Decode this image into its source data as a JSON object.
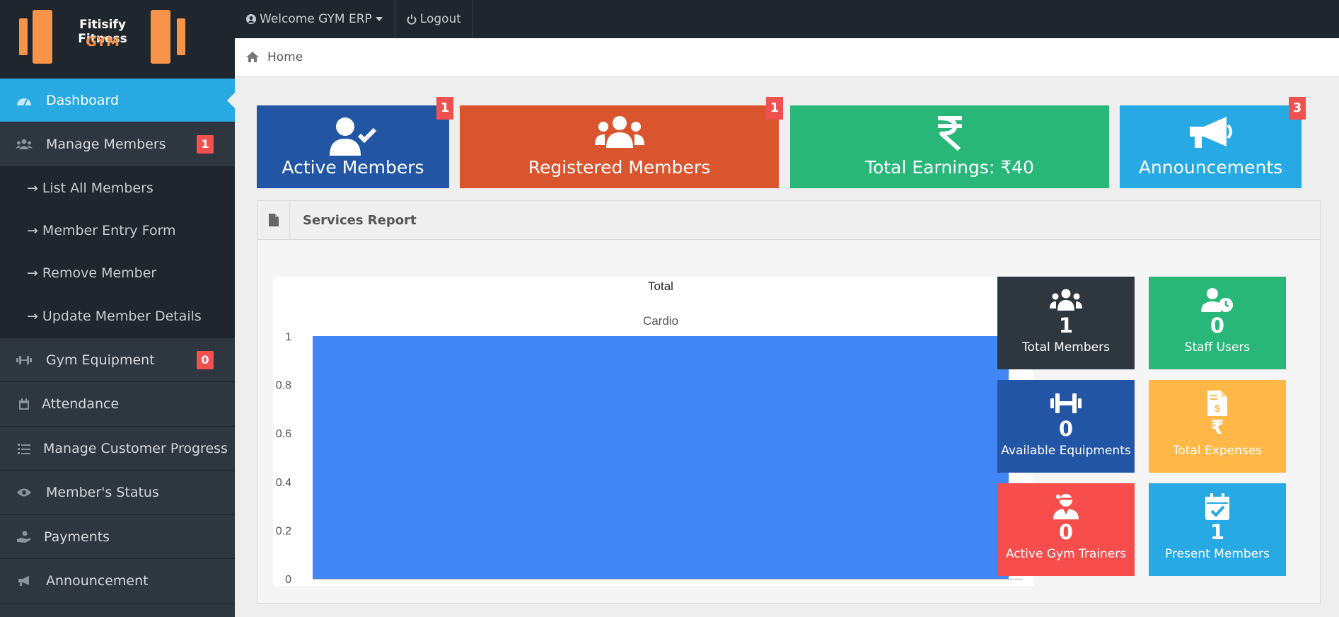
{
  "brand": {
    "line1": "Fitisify Fitness",
    "line2": "GYM"
  },
  "topbar": {
    "welcome": "Welcome GYM ERP",
    "logout": "Logout"
  },
  "breadcrumb": {
    "home": "Home"
  },
  "sidebar": {
    "dashboard": "Dashboard",
    "manage_members": {
      "label": "Manage Members",
      "badge": "1"
    },
    "submenu": [
      "List All Members",
      "Member Entry Form",
      "Remove Member",
      "Update Member Details"
    ],
    "gym_equipment": {
      "label": "Gym Equipment",
      "badge": "0"
    },
    "attendance": "Attendance",
    "customer_progress": "Manage Customer Progress",
    "member_status": "Member's Status",
    "payments": "Payments",
    "announcement": "Announcement"
  },
  "tiles": {
    "active": {
      "label": "Active Members",
      "badge": "1",
      "color": "#2255a4"
    },
    "registered": {
      "label": "Registered Members",
      "badge": "1",
      "color": "#da542e"
    },
    "earnings": {
      "label": "Total Earnings: ₹40",
      "color": "#28b779"
    },
    "announcements": {
      "label": "Announcements",
      "badge": "3",
      "color": "#27a9e3"
    }
  },
  "panel": {
    "title": "Services Report"
  },
  "chart_data": {
    "type": "bar",
    "title": "Total",
    "categories": [
      "Cardio"
    ],
    "values": [
      1
    ],
    "ylim": [
      0,
      1
    ],
    "yticks": [
      "0",
      "0.2",
      "0.4",
      "0.6",
      "0.8",
      "1"
    ],
    "bar_color": "#4285f4",
    "grid": false
  },
  "stats": {
    "total_members": {
      "value": "1",
      "label": "Total Members",
      "color": "#2e363f"
    },
    "staff_users": {
      "value": "0",
      "label": "Staff Users",
      "color": "#28b779"
    },
    "equipments": {
      "value": "0",
      "label": "Available Equipments",
      "color": "#2255a4"
    },
    "expenses": {
      "value": "₹",
      "label": "Total Expenses",
      "color": "#ffb848"
    },
    "trainers": {
      "value": "0",
      "label": "Active Gym Trainers",
      "color": "#f74d4d"
    },
    "present": {
      "value": "1",
      "label": "Present Members",
      "color": "#27a9e3"
    }
  }
}
